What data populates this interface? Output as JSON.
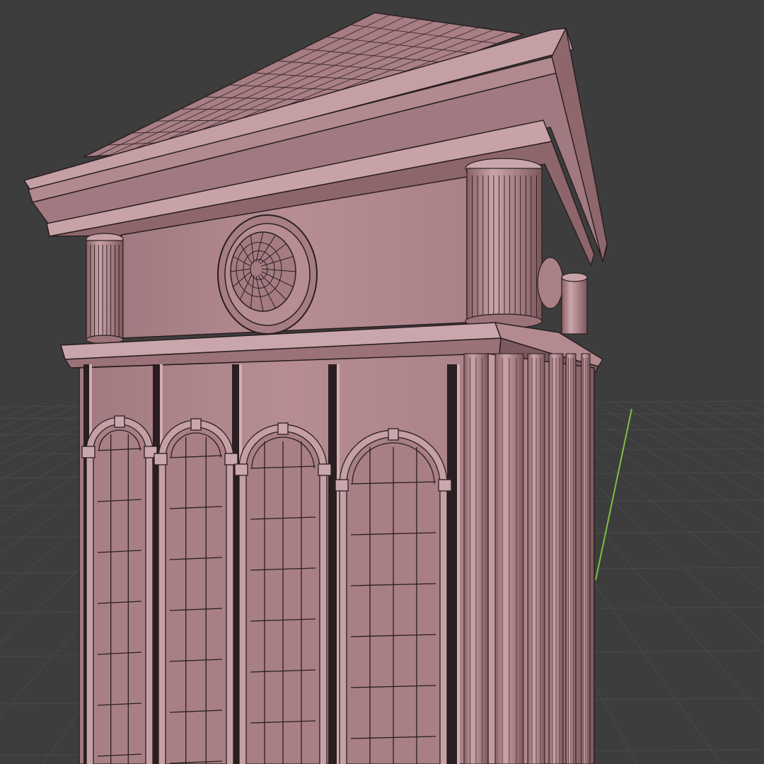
{
  "viewport": {
    "background": "#3d3d3d",
    "grid_line_color": "#4a4a4a",
    "y_axis_color": "#7fbf3f",
    "model_color": "#b48a90",
    "model_shadow": "#8a6066",
    "model_highlight": "#d3b2b6",
    "wire_color": "#2a1e20"
  },
  "model": {
    "arched_window_count": 4,
    "round_medallion_count": 1,
    "column_count": 3
  }
}
